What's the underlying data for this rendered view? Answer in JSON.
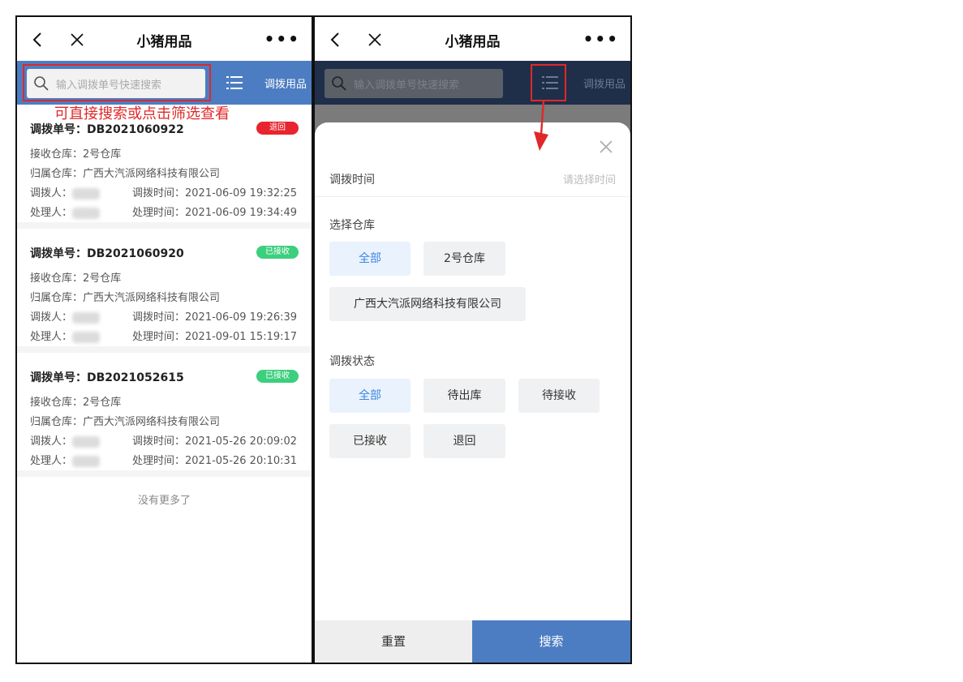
{
  "nav": {
    "title": "小猪用品",
    "more": "•••"
  },
  "search": {
    "placeholder": "输入调拨单号快速搜索",
    "transfer_link": "调拨用品"
  },
  "annotation": "可直接搜索或点击筛选查看",
  "records": [
    {
      "order_label": "调拨单号：",
      "order_no": "DB2021060922",
      "status": "退回",
      "status_color": "#e8242f",
      "receive_wh": "接收仓库：2号仓库",
      "owner_wh": "归属仓库：广西大汽派网络科技有限公司",
      "transfer_person": "调拨人：",
      "transfer_time": "调拨时间：2021-06-09 19:32:25",
      "handler": "处理人：",
      "handle_time": "处理时间：2021-06-09 19:34:49"
    },
    {
      "order_label": "调拨单号：",
      "order_no": "DB2021060920",
      "status": "已接收",
      "status_color": "#3ccf7e",
      "receive_wh": "接收仓库：2号仓库",
      "owner_wh": "归属仓库：广西大汽派网络科技有限公司",
      "transfer_person": "调拨人：",
      "transfer_time": "调拨时间：2021-06-09 19:26:39",
      "handler": "处理人：",
      "handle_time": "处理时间：2021-09-01 15:19:17"
    },
    {
      "order_label": "调拨单号：",
      "order_no": "DB2021052615",
      "status": "已接收",
      "status_color": "#3ccf7e",
      "receive_wh": "接收仓库：2号仓库",
      "owner_wh": "归属仓库：广西大汽派网络科技有限公司",
      "transfer_person": "调拨人：",
      "transfer_time": "调拨时间：2021-05-26 20:09:02",
      "handler": "处理人：",
      "handle_time": "处理时间：2021-05-26 20:10:31"
    }
  ],
  "no_more": "没有更多了",
  "filter": {
    "time_label": "调拨时间",
    "time_placeholder": "请选择时间",
    "warehouse_title": "选择仓库",
    "warehouse_options": [
      "全部",
      "2号仓库",
      "广西大汽派网络科技有限公司"
    ],
    "status_title": "调拨状态",
    "status_options": [
      "全部",
      "待出库",
      "待接收",
      "已接收",
      "退回"
    ],
    "reset": "重置",
    "search": "搜索"
  },
  "colors": {
    "primary": "#4c7dc2",
    "annotation": "#e02828",
    "active_chip": "#3d86e0"
  }
}
